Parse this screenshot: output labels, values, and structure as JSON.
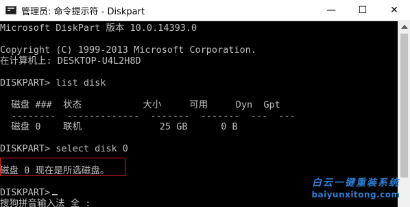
{
  "window": {
    "title": "管理员: 命令提示符 - Diskpart",
    "controls": {
      "minimize": "—",
      "maximize": "☐",
      "close": "✕"
    }
  },
  "console": {
    "lines": [
      "Microsoft DiskPart 版本 10.0.14393.0",
      "",
      "Copyright (C) 1999-2013 Microsoft Corporation.",
      "在计算机上: DESKTOP-U4L2H8D",
      "",
      "DISKPART> list disk",
      "",
      "  磁盘 ###  状态           大小     可用     Dyn  Gpt",
      "  --------  -------------  -------  -------  ---  ---",
      "  磁盘 0    联机              25 GB      0 B",
      "",
      "DISKPART> select disk 0",
      "",
      "磁盘 0 现在是所选磁盘。",
      "",
      "DISKPART>",
      "搜狗拼音输入法 全 :"
    ]
  },
  "watermark": {
    "title": "白云一键重装系统",
    "url": "baiyunxitong.com"
  },
  "colors": {
    "console_text": "#c0c0c0",
    "console_bg": "#000000",
    "highlight_border": "#e02020",
    "watermark": "#2b7fd4"
  }
}
